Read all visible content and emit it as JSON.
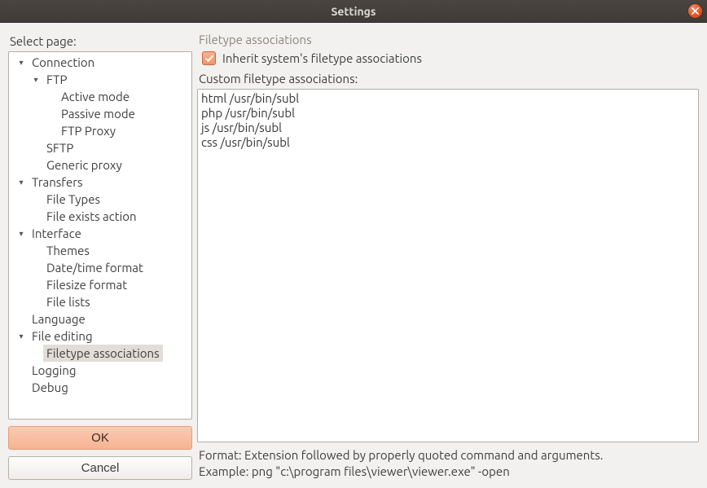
{
  "window": {
    "title": "Settings"
  },
  "sidebar": {
    "label": "Select page:",
    "tree": [
      {
        "level": 0,
        "expandable": true,
        "expanded": true,
        "label": "Connection",
        "selected": false
      },
      {
        "level": 1,
        "expandable": true,
        "expanded": true,
        "label": "FTP",
        "selected": false
      },
      {
        "level": 2,
        "expandable": false,
        "label": "Active mode",
        "selected": false
      },
      {
        "level": 2,
        "expandable": false,
        "label": "Passive mode",
        "selected": false
      },
      {
        "level": 2,
        "expandable": false,
        "label": "FTP Proxy",
        "selected": false
      },
      {
        "level": 1,
        "expandable": false,
        "label": "SFTP",
        "selected": false
      },
      {
        "level": 1,
        "expandable": false,
        "label": "Generic proxy",
        "selected": false
      },
      {
        "level": 0,
        "expandable": true,
        "expanded": true,
        "label": "Transfers",
        "selected": false
      },
      {
        "level": 1,
        "expandable": false,
        "label": "File Types",
        "selected": false
      },
      {
        "level": 1,
        "expandable": false,
        "label": "File exists action",
        "selected": false
      },
      {
        "level": 0,
        "expandable": true,
        "expanded": true,
        "label": "Interface",
        "selected": false
      },
      {
        "level": 1,
        "expandable": false,
        "label": "Themes",
        "selected": false
      },
      {
        "level": 1,
        "expandable": false,
        "label": "Date/time format",
        "selected": false
      },
      {
        "level": 1,
        "expandable": false,
        "label": "Filesize format",
        "selected": false
      },
      {
        "level": 1,
        "expandable": false,
        "label": "File lists",
        "selected": false
      },
      {
        "level": 0,
        "expandable": false,
        "label": "Language",
        "selected": false
      },
      {
        "level": 0,
        "expandable": true,
        "expanded": true,
        "label": "File editing",
        "selected": false
      },
      {
        "level": 1,
        "expandable": false,
        "label": "Filetype associations",
        "selected": true
      },
      {
        "level": 0,
        "expandable": false,
        "label": "Logging",
        "selected": false
      },
      {
        "level": 0,
        "expandable": false,
        "label": "Debug",
        "selected": false
      }
    ]
  },
  "buttons": {
    "ok": "OK",
    "cancel": "Cancel"
  },
  "main": {
    "heading": "Filetype associations",
    "inherit_checkbox": {
      "checked": true,
      "label": "Inherit system's filetype associations"
    },
    "custom_label": "Custom filetype associations:",
    "custom_value": "html /usr/bin/subl\nphp /usr/bin/subl\njs /usr/bin/subl\ncss /usr/bin/subl",
    "format_hint": "Format: Extension followed by properly quoted command and arguments.",
    "example_hint": "Example: png \"c:\\program files\\viewer\\viewer.exe\" -open"
  }
}
